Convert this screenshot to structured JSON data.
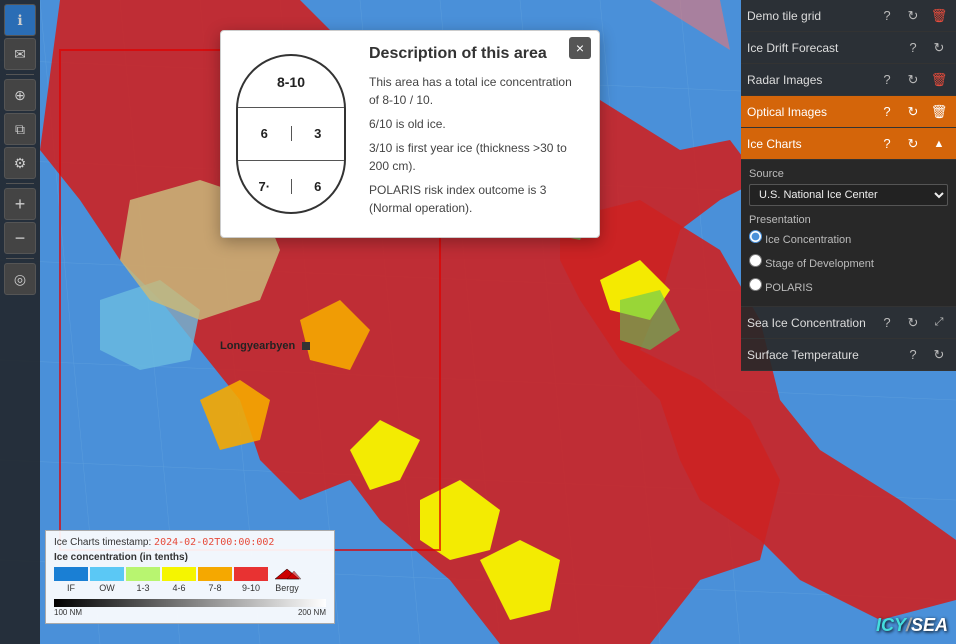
{
  "map": {
    "city": "Longyearbyen",
    "bg_color": "#4a90d9"
  },
  "toolbar": {
    "buttons": [
      {
        "id": "info",
        "icon": "ℹ",
        "active": true
      },
      {
        "id": "mail",
        "icon": "✉"
      },
      {
        "id": "location",
        "icon": "⊕"
      },
      {
        "id": "layers",
        "icon": "⧉"
      },
      {
        "id": "settings",
        "icon": "⚙"
      },
      {
        "id": "zoom-in",
        "icon": "+"
      },
      {
        "id": "zoom-out",
        "icon": "−"
      },
      {
        "id": "compass",
        "icon": "◎"
      }
    ]
  },
  "right_panel": {
    "rows": [
      {
        "id": "demo-tile",
        "label": "Demo tile grid",
        "has_help": true,
        "has_refresh": true,
        "has_delete": true,
        "active": false
      },
      {
        "id": "ice-drift",
        "label": "Ice Drift Forecast",
        "has_help": true,
        "has_refresh": true,
        "has_delete": false,
        "active": false
      },
      {
        "id": "radar",
        "label": "Radar Images",
        "has_help": true,
        "has_refresh": true,
        "has_delete": true,
        "active": false
      },
      {
        "id": "optical",
        "label": "Optical Images",
        "has_help": true,
        "has_refresh": true,
        "has_delete": true,
        "active": true
      },
      {
        "id": "ice-charts",
        "label": "Ice Charts",
        "has_help": true,
        "has_refresh": true,
        "has_delete": false,
        "active": true,
        "expanded": true
      }
    ],
    "ice_charts_section": {
      "source_label": "Source",
      "source_value": "U.S. National Ice Center",
      "source_options": [
        "U.S. National Ice Center"
      ],
      "presentation_label": "Presentation",
      "radio_options": [
        {
          "id": "ice-concentration",
          "label": "Ice Concentration",
          "checked": true
        },
        {
          "id": "stage-dev",
          "label": "Stage of Development",
          "checked": false
        },
        {
          "id": "polaris",
          "label": "POLARIS",
          "checked": false
        }
      ]
    },
    "bottom_rows": [
      {
        "id": "sea-ice",
        "label": "Sea Ice Concentration",
        "has_help": true,
        "has_refresh": true,
        "has_expand": true
      },
      {
        "id": "surface-temp",
        "label": "Surface Temperature",
        "has_help": true,
        "has_refresh": true,
        "has_expand": false
      }
    ]
  },
  "popup": {
    "title": "Description of this area",
    "close_label": "×",
    "diagram": {
      "top": "8-10",
      "mid_left": "6",
      "mid_right": "3",
      "bot_left": "7·",
      "bot_right": "6"
    },
    "paragraphs": [
      "This area has a total ice concentration of 8-10 / 10.",
      "6/10 is old ice.",
      "3/10 is first year ice (thickness >30 to 200 cm).",
      "POLARIS risk index outcome is 3 (Normal operation)."
    ]
  },
  "legend": {
    "timestamp_label": "Ice Charts timestamp:",
    "timestamp_value": "2024-02-02T00:00:002",
    "concentration_label": "Ice concentration (in tenths)",
    "swatches": [
      {
        "label": "IF",
        "color": "#1a7fd4"
      },
      {
        "label": "OW",
        "color": "#5bc8f5"
      },
      {
        "label": "1-3",
        "color": "#b8f570"
      },
      {
        "label": "4-6",
        "color": "#f5f500"
      },
      {
        "label": "7-8",
        "color": "#f5a800"
      },
      {
        "label": "9-10",
        "color": "#e83232"
      },
      {
        "label": "Bergy",
        "color": "#cc0000",
        "is_triangle": true
      }
    ],
    "scale_labels": [
      "100 NM",
      "200 NM"
    ]
  },
  "logo": {
    "text": "ICY/SEA"
  }
}
